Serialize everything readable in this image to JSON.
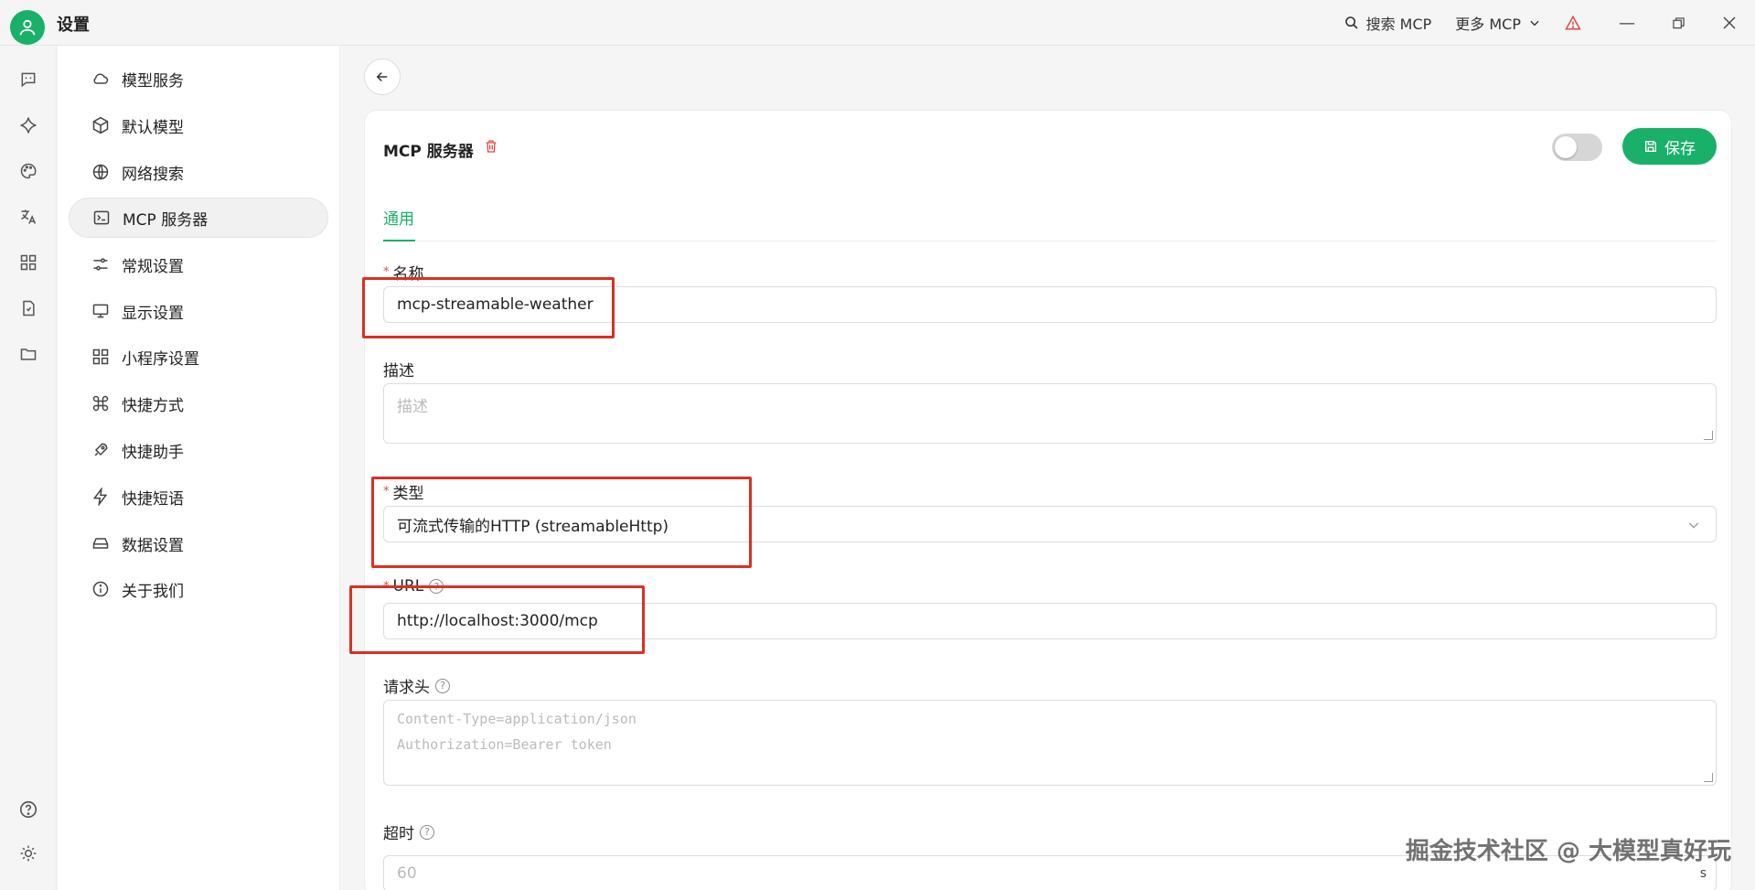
{
  "titlebar": {
    "title": "设置",
    "search_mcp": "搜索 MCP",
    "more_mcp": "更多 MCP"
  },
  "sidebar": {
    "items": [
      {
        "label": "模型服务",
        "icon": "cloud-icon"
      },
      {
        "label": "默认模型",
        "icon": "cube-icon"
      },
      {
        "label": "网络搜索",
        "icon": "globe-icon"
      },
      {
        "label": "MCP 服务器",
        "icon": "terminal-icon",
        "active": true
      },
      {
        "label": "常规设置",
        "icon": "sliders-icon"
      },
      {
        "label": "显示设置",
        "icon": "monitor-icon"
      },
      {
        "label": "小程序设置",
        "icon": "grid-icon"
      },
      {
        "label": "快捷方式",
        "icon": "command-icon"
      },
      {
        "label": "快捷助手",
        "icon": "rocket-icon"
      },
      {
        "label": "快捷短语",
        "icon": "zap-icon"
      },
      {
        "label": "数据设置",
        "icon": "drive-icon"
      },
      {
        "label": "关于我们",
        "icon": "info-icon"
      }
    ]
  },
  "card": {
    "title": "MCP 服务器",
    "save_label": "保存",
    "tab_general": "通用"
  },
  "form": {
    "name_label": "名称",
    "name_value": "mcp-streamable-weather",
    "desc_label": "描述",
    "desc_placeholder": "描述",
    "type_label": "类型",
    "type_value": "可流式传输的HTTP (streamableHttp)",
    "url_label": "URL",
    "url_value": "http://localhost:3000/mcp",
    "headers_label": "请求头",
    "headers_placeholder_1": "Content-Type=application/json",
    "headers_placeholder_2": "Authorization=Bearer token",
    "timeout_label": "超时",
    "timeout_placeholder": "60",
    "timeout_unit": "s"
  },
  "watermark": "掘金技术社区 @ 大模型真好玩",
  "colors": {
    "accent": "#19b06a",
    "highlight_box": "#d93025",
    "danger": "#e04848"
  }
}
